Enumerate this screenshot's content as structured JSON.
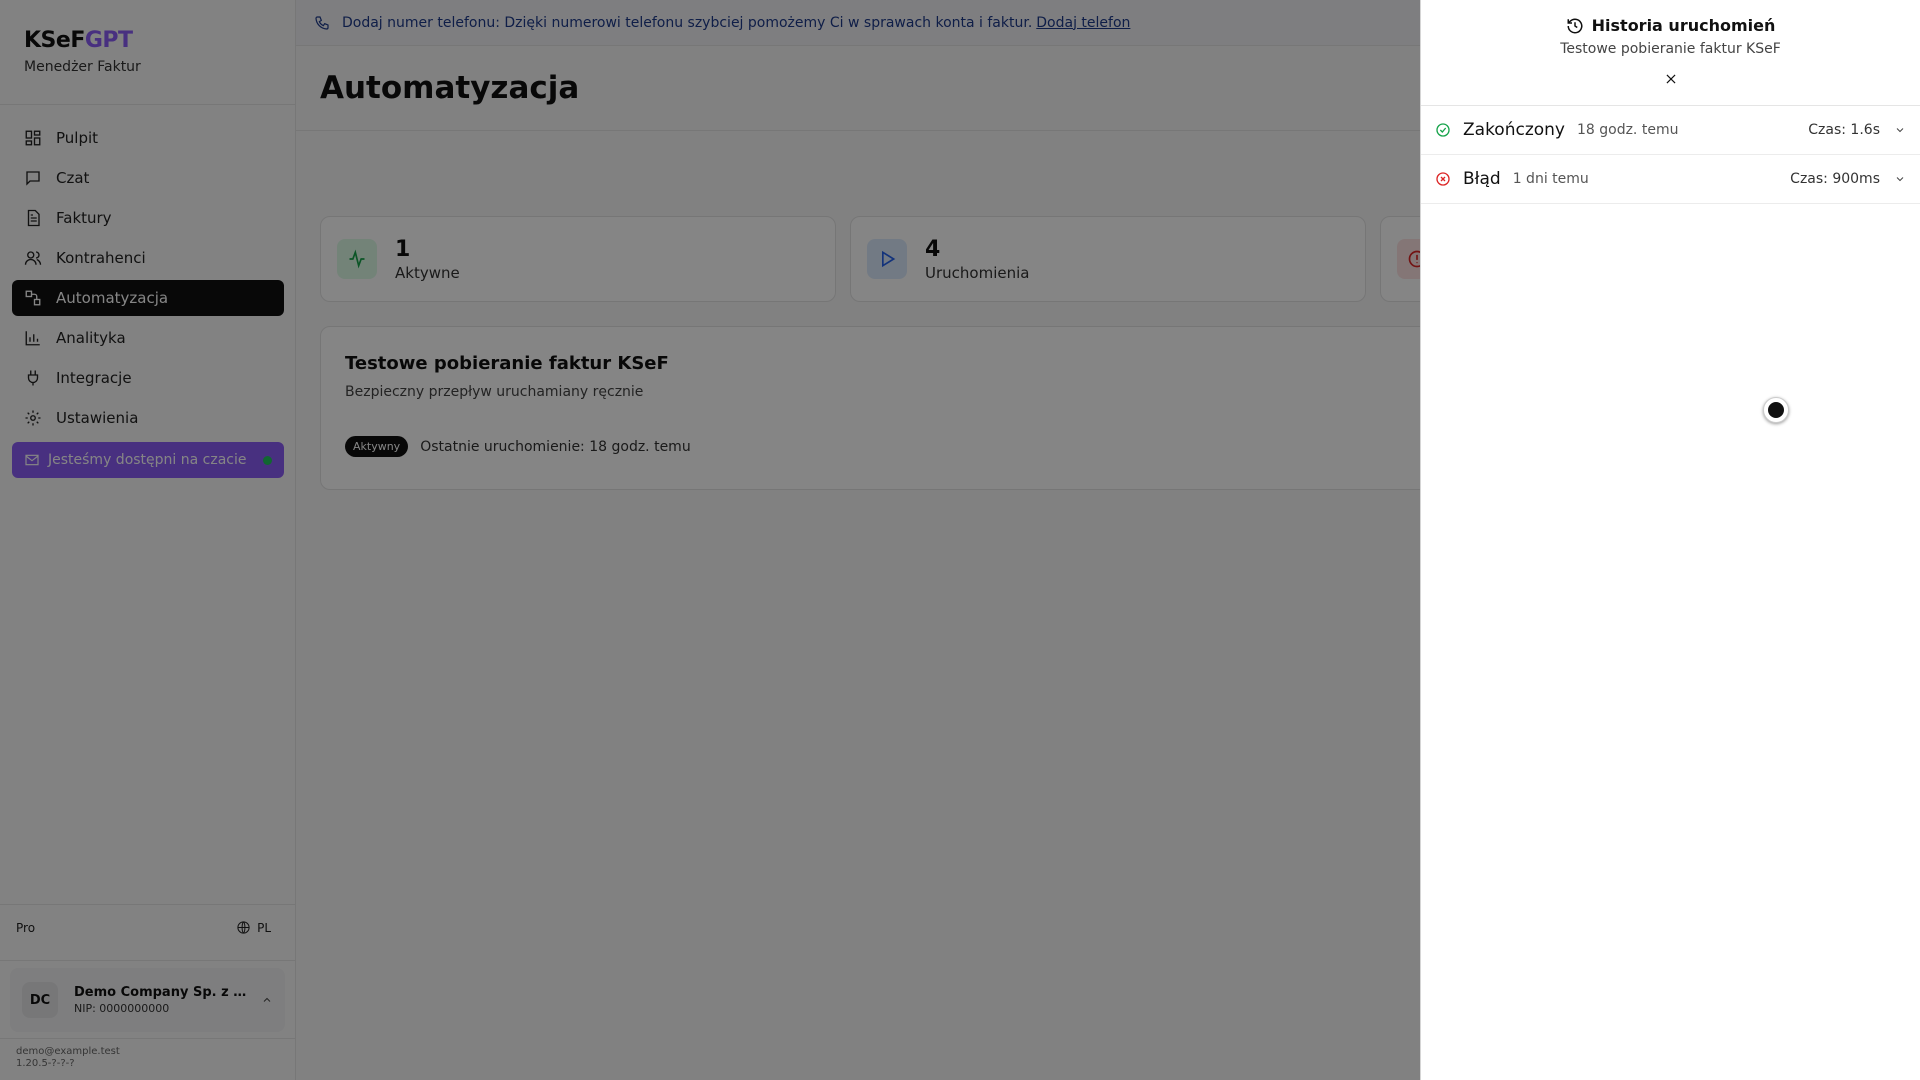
{
  "sidebar": {
    "logo_prefix": "KSeF",
    "logo_suffix": "GPT",
    "subtitle": "Menedżer Faktur",
    "items": [
      {
        "label": "Pulpit",
        "icon": "dashboard-icon"
      },
      {
        "label": "Czat",
        "icon": "chat-icon"
      },
      {
        "label": "Faktury",
        "icon": "invoice-icon"
      },
      {
        "label": "Kontrahenci",
        "icon": "users-icon"
      },
      {
        "label": "Automatyzacja",
        "icon": "workflow-icon",
        "active": true
      },
      {
        "label": "Analityka",
        "icon": "chart-icon"
      },
      {
        "label": "Integracje",
        "icon": "plug-icon"
      },
      {
        "label": "Ustawienia",
        "icon": "gear-icon"
      }
    ],
    "chat_cta": "Jesteśmy dostępni na czacie",
    "plan": "Pro",
    "language": "PL",
    "company": {
      "initials": "DC",
      "name": "Demo Company Sp. z o.o.",
      "nip": "NIP: 0000000000"
    },
    "footer_email": "demo@example.test",
    "footer_version": "1.20.5-?-?-?"
  },
  "banner": {
    "text": "Dodaj numer telefonu: Dzięki numerowi telefonu szybciej pomożemy Ci w sprawach konta i faktur.",
    "link": "Dodaj telefon"
  },
  "main": {
    "title": "Automatyzacja",
    "stats": [
      {
        "value": "1",
        "label": "Aktywne",
        "color": "#16a34a"
      },
      {
        "value": "4",
        "label": "Uruchomienia",
        "color": "#2563eb"
      }
    ],
    "flow": {
      "name": "Testowe pobieranie faktur KSeF",
      "description": "Bezpieczny przepływ uruchamiany ręcznie",
      "badge": "Aktywny",
      "last_run": "Ostatnie uruchomienie: 18 godz. temu"
    }
  },
  "drawer": {
    "title": "Historia uruchomień",
    "subtitle": "Testowe pobieranie faktur KSeF",
    "runs": [
      {
        "status": "Zakończony",
        "ago": "18 godz. temu",
        "duration": "Czas: 1.6s",
        "color": "#16a34a"
      },
      {
        "status": "Błąd",
        "ago": "1 dni temu",
        "duration": "Czas: 900ms",
        "color": "#dc2626"
      }
    ]
  }
}
